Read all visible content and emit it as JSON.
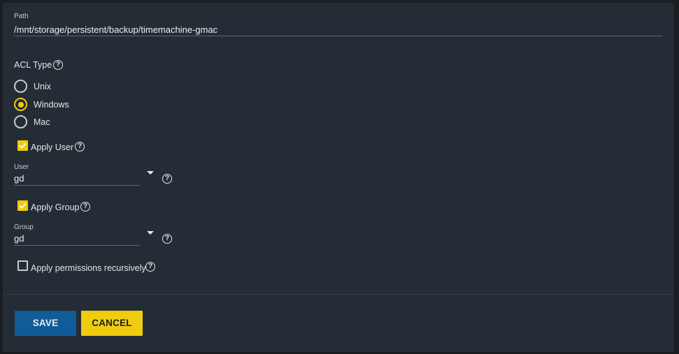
{
  "path": {
    "label": "Path",
    "value": "/mnt/storage/persistent/backup/timemachine-gmac"
  },
  "acl_type": {
    "label": "ACL Type",
    "help": "?",
    "options": [
      {
        "label": "Unix",
        "selected": false
      },
      {
        "label": "Windows",
        "selected": true
      },
      {
        "label": "Mac",
        "selected": false
      }
    ]
  },
  "apply_user": {
    "label": "Apply User",
    "checked": true,
    "help": "?"
  },
  "user": {
    "label": "User",
    "value": "gd",
    "help": "?"
  },
  "apply_group": {
    "label": "Apply Group",
    "checked": true,
    "help": "?"
  },
  "group": {
    "label": "Group",
    "value": "gd",
    "help": "?"
  },
  "recursive": {
    "label": "Apply permissions recursively",
    "checked": false,
    "help": "?"
  },
  "buttons": {
    "save": "SAVE",
    "cancel": "CANCEL"
  },
  "colors": {
    "accent": "#f0cc0f",
    "primary": "#0f5c98",
    "panel": "#242c35"
  },
  "icons": {
    "help": "help-circle-icon",
    "check": "checkmark-icon",
    "dropdown": "caret-down-icon"
  }
}
